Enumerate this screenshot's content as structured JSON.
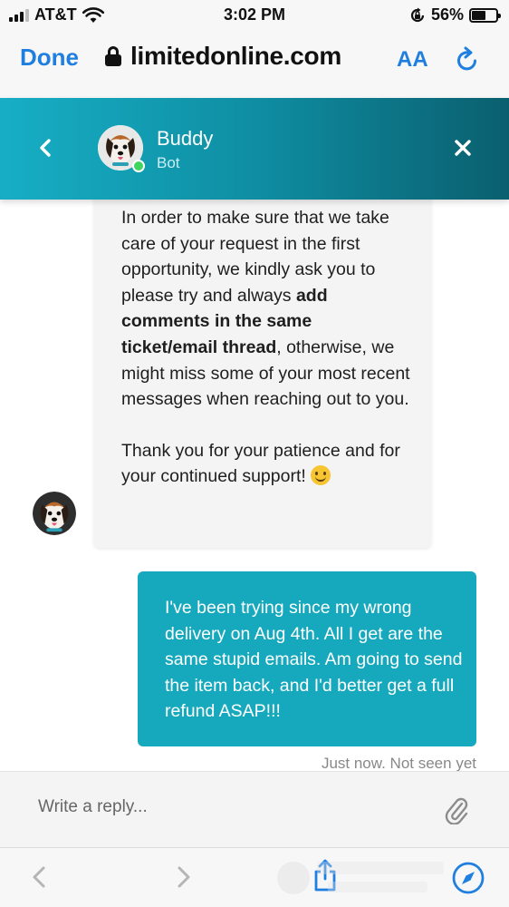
{
  "status_bar": {
    "carrier": "AT&T",
    "time": "3:02 PM",
    "battery_percent": "56%",
    "battery_level": 0.56,
    "icons": [
      "signal-icon",
      "wifi-icon",
      "orientation-lock-icon",
      "battery-icon"
    ]
  },
  "browser": {
    "done_label": "Done",
    "url": "limitedonline.com",
    "text_size_label": "AA",
    "icons": [
      "lock-icon",
      "reload-icon"
    ]
  },
  "chat_header": {
    "name": "Buddy",
    "role": "Bot",
    "icons": [
      "back-chevron-icon",
      "close-icon"
    ],
    "accent_colors": [
      "#17aec5",
      "#0a5f6e"
    ],
    "online_color": "#3fd45e"
  },
  "messages": {
    "bot_message": {
      "part1": "In order to make sure that we take care of your request in the first opportunity, we kindly ask you to please try and always ",
      "bold": "add comments in the same ticket/email thread",
      "part2": ", otherwise, we might miss some of your most recent messages when reaching out to you.",
      "para2": "Thank you for your patience and for your continued support! ",
      "emoji": "smiling-face-icon"
    },
    "user_message": {
      "text": "I've been trying since my wrong delivery on Aug 4th. All I get are the same stupid emails. Am going to send the item back, and I'd better get a full refund ASAP!!!",
      "bubble_color": "#16a9bd"
    },
    "meta": "Just now. Not seen yet"
  },
  "composer": {
    "placeholder": "Write a reply...",
    "icons": [
      "paperclip-icon"
    ]
  },
  "toolbar": {
    "icons": [
      "back-arrow-icon",
      "forward-arrow-icon",
      "share-icon",
      "compass-icon"
    ]
  }
}
